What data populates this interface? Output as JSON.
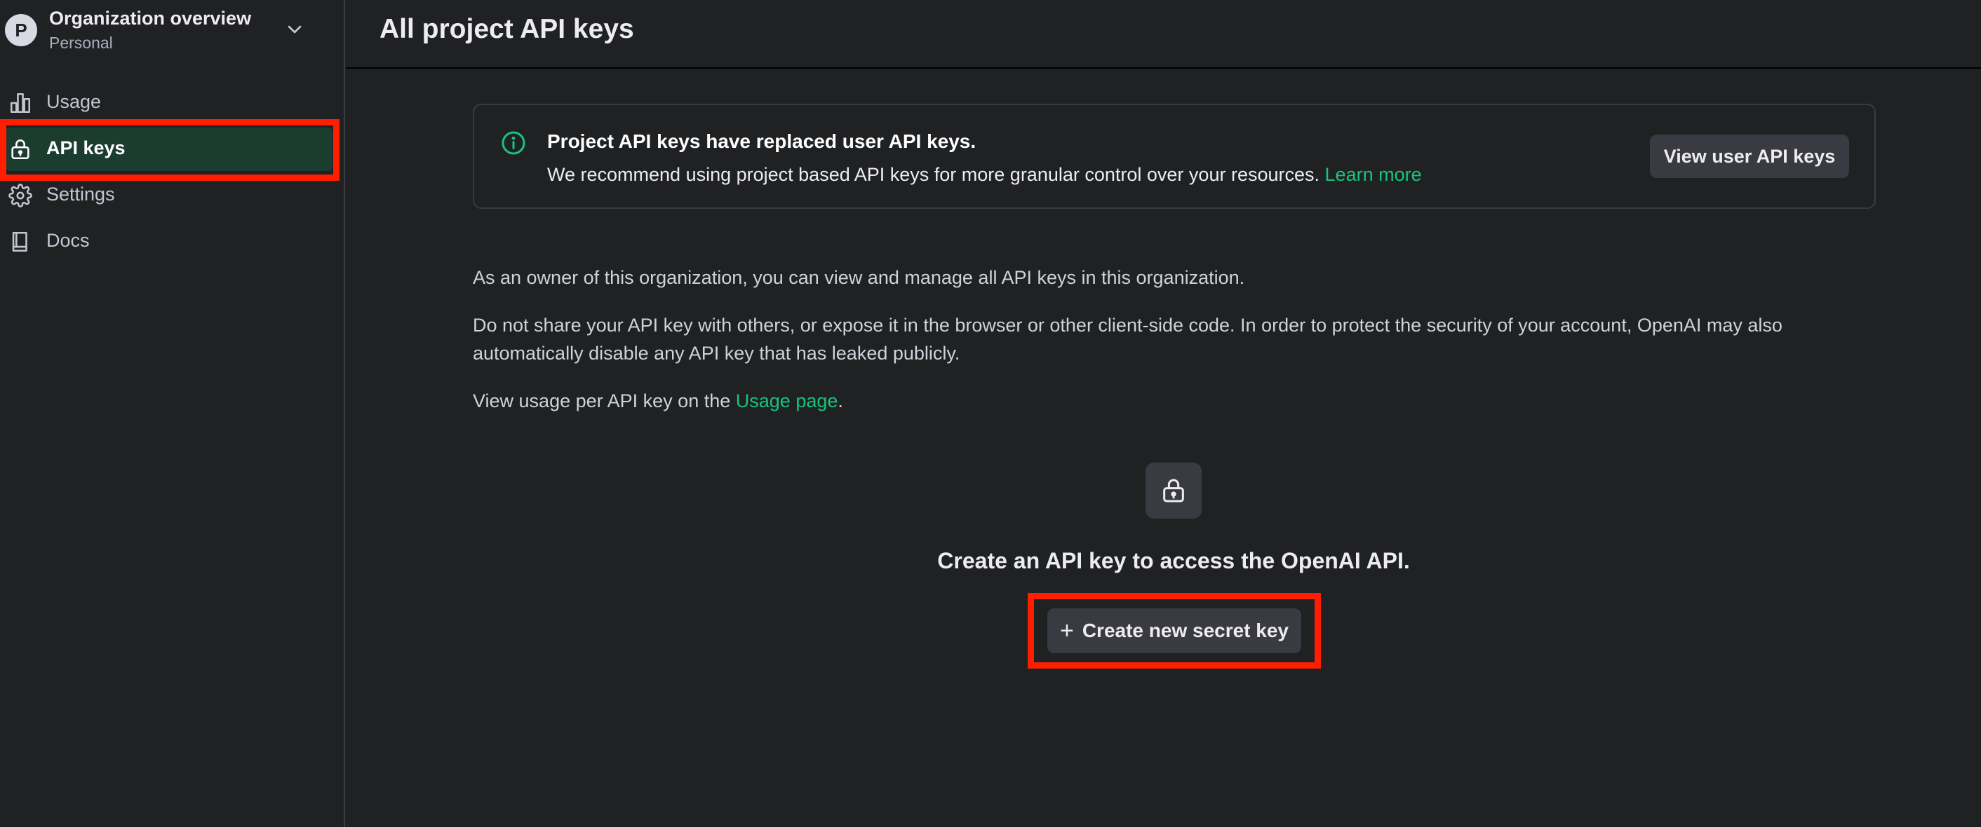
{
  "org": {
    "avatar_letter": "P",
    "title": "Organization overview",
    "subtitle": "Personal"
  },
  "sidebar": {
    "items": [
      {
        "label": "Usage",
        "icon": "bar-chart-icon"
      },
      {
        "label": "API keys",
        "icon": "lock-icon",
        "active": true
      },
      {
        "label": "Settings",
        "icon": "gear-icon"
      },
      {
        "label": "Docs",
        "icon": "book-icon"
      }
    ]
  },
  "header": {
    "title": "All project API keys"
  },
  "banner": {
    "title": "Project API keys have replaced user API keys.",
    "body": "We recommend using project based API keys for more granular control over your resources.",
    "link": "Learn more",
    "button": "View user API keys"
  },
  "main": {
    "para1": "As an owner of this organization, you can view and manage all API keys in this organization.",
    "para2_line1": "Do not share your API key with others, or expose it in the browser or other client-side code. In order to protect the security of your account, OpenAI may also",
    "para2_line2": "automatically disable any API key that has leaked publicly.",
    "para3_prefix": "View usage per API key on the",
    "para3_link": "Usage page",
    "para3_suffix": ".",
    "empty_heading": "Create an API key to access the OpenAI API.",
    "create_button": "Create new secret key"
  },
  "colors": {
    "accent": "#19c37d",
    "active_nav_bg": "#1a3d2f",
    "highlight": "#ff1e00",
    "background": "#202123"
  }
}
